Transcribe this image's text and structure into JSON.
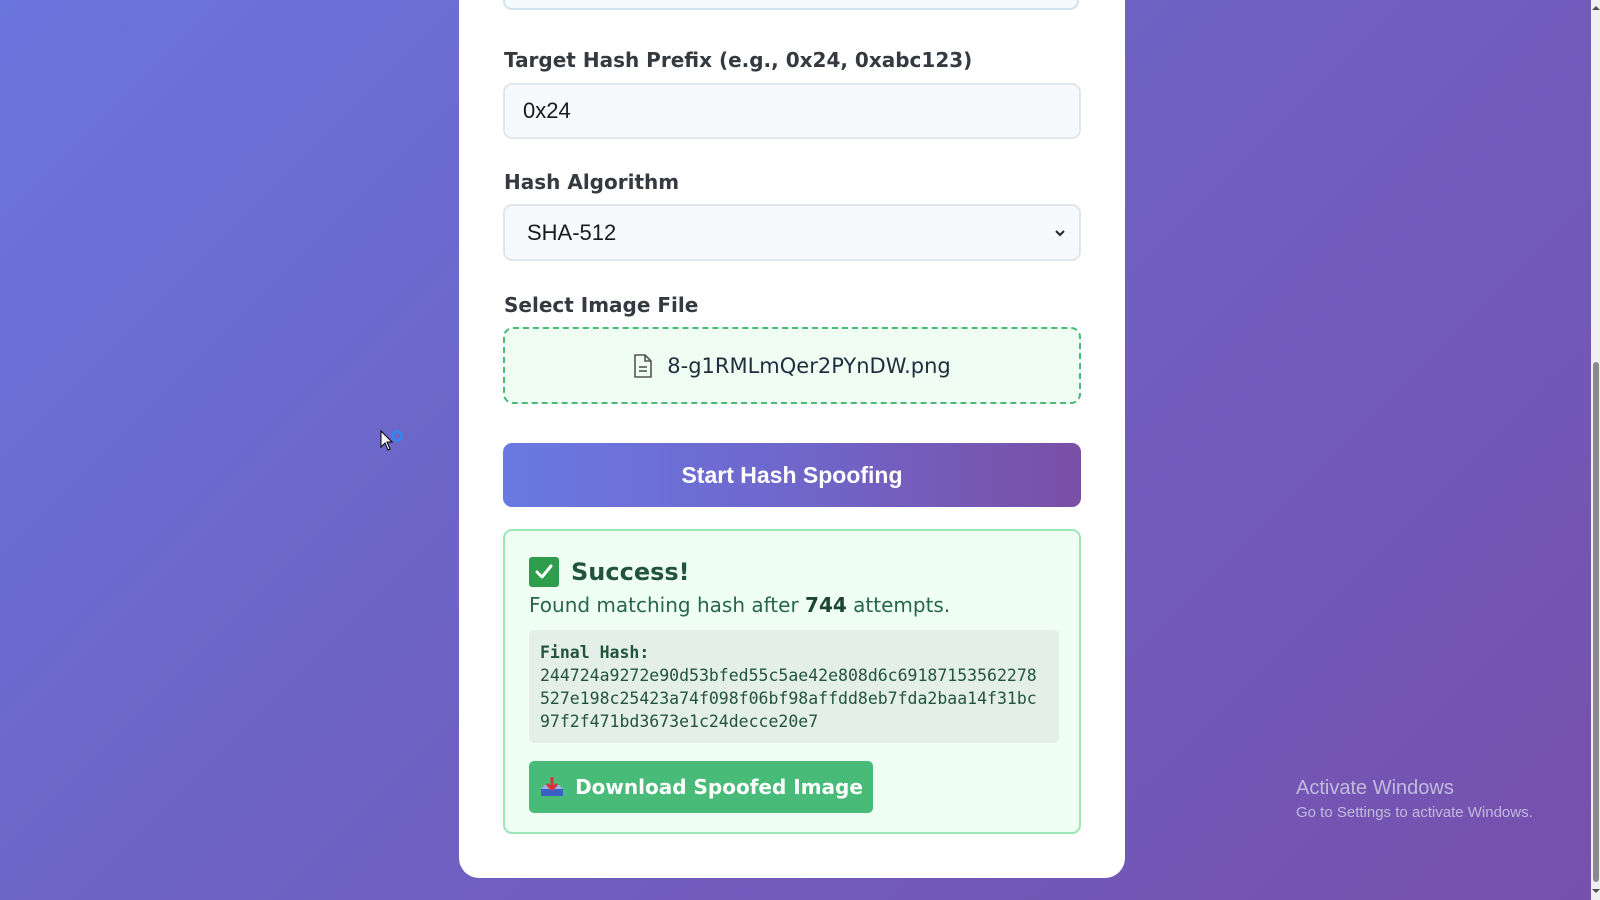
{
  "form": {
    "prefix_label": "Target Hash Prefix (e.g., 0x24, 0xabc123)",
    "prefix_value": "0x24",
    "algorithm_label": "Hash Algorithm",
    "algorithm_selected": "SHA-512",
    "file_label": "Select Image File",
    "file_name": "8-g1RMLmQer2PYnDW.png",
    "submit_label": "Start Hash Spoofing"
  },
  "result": {
    "title": "Success!",
    "message_prefix": "Found matching hash after",
    "attempts": "744",
    "message_suffix": "attempts.",
    "hash_title": "Final Hash:",
    "hash_value": "244724a9272e90d53bfed55c5ae42e808d6c69187153562278527e198c25423a74f098f06bf98affdd8eb7fda2baa14f31bc97f2f471bd3673e1c24decce20e7",
    "download_label": "Download Spoofed Image"
  },
  "watermark": {
    "line1": "Activate Windows",
    "line2": "Go to Settings to activate Windows."
  },
  "icons": {
    "file": "file-document-icon",
    "check": "checkmark-box-icon",
    "download": "download-tray-icon",
    "select": "chevron-down-icon"
  },
  "colors": {
    "success_green": "#48bb78",
    "accent_start": "#6a79e3",
    "accent_end": "#7a4fa6",
    "text_dark_green": "#22543d"
  }
}
